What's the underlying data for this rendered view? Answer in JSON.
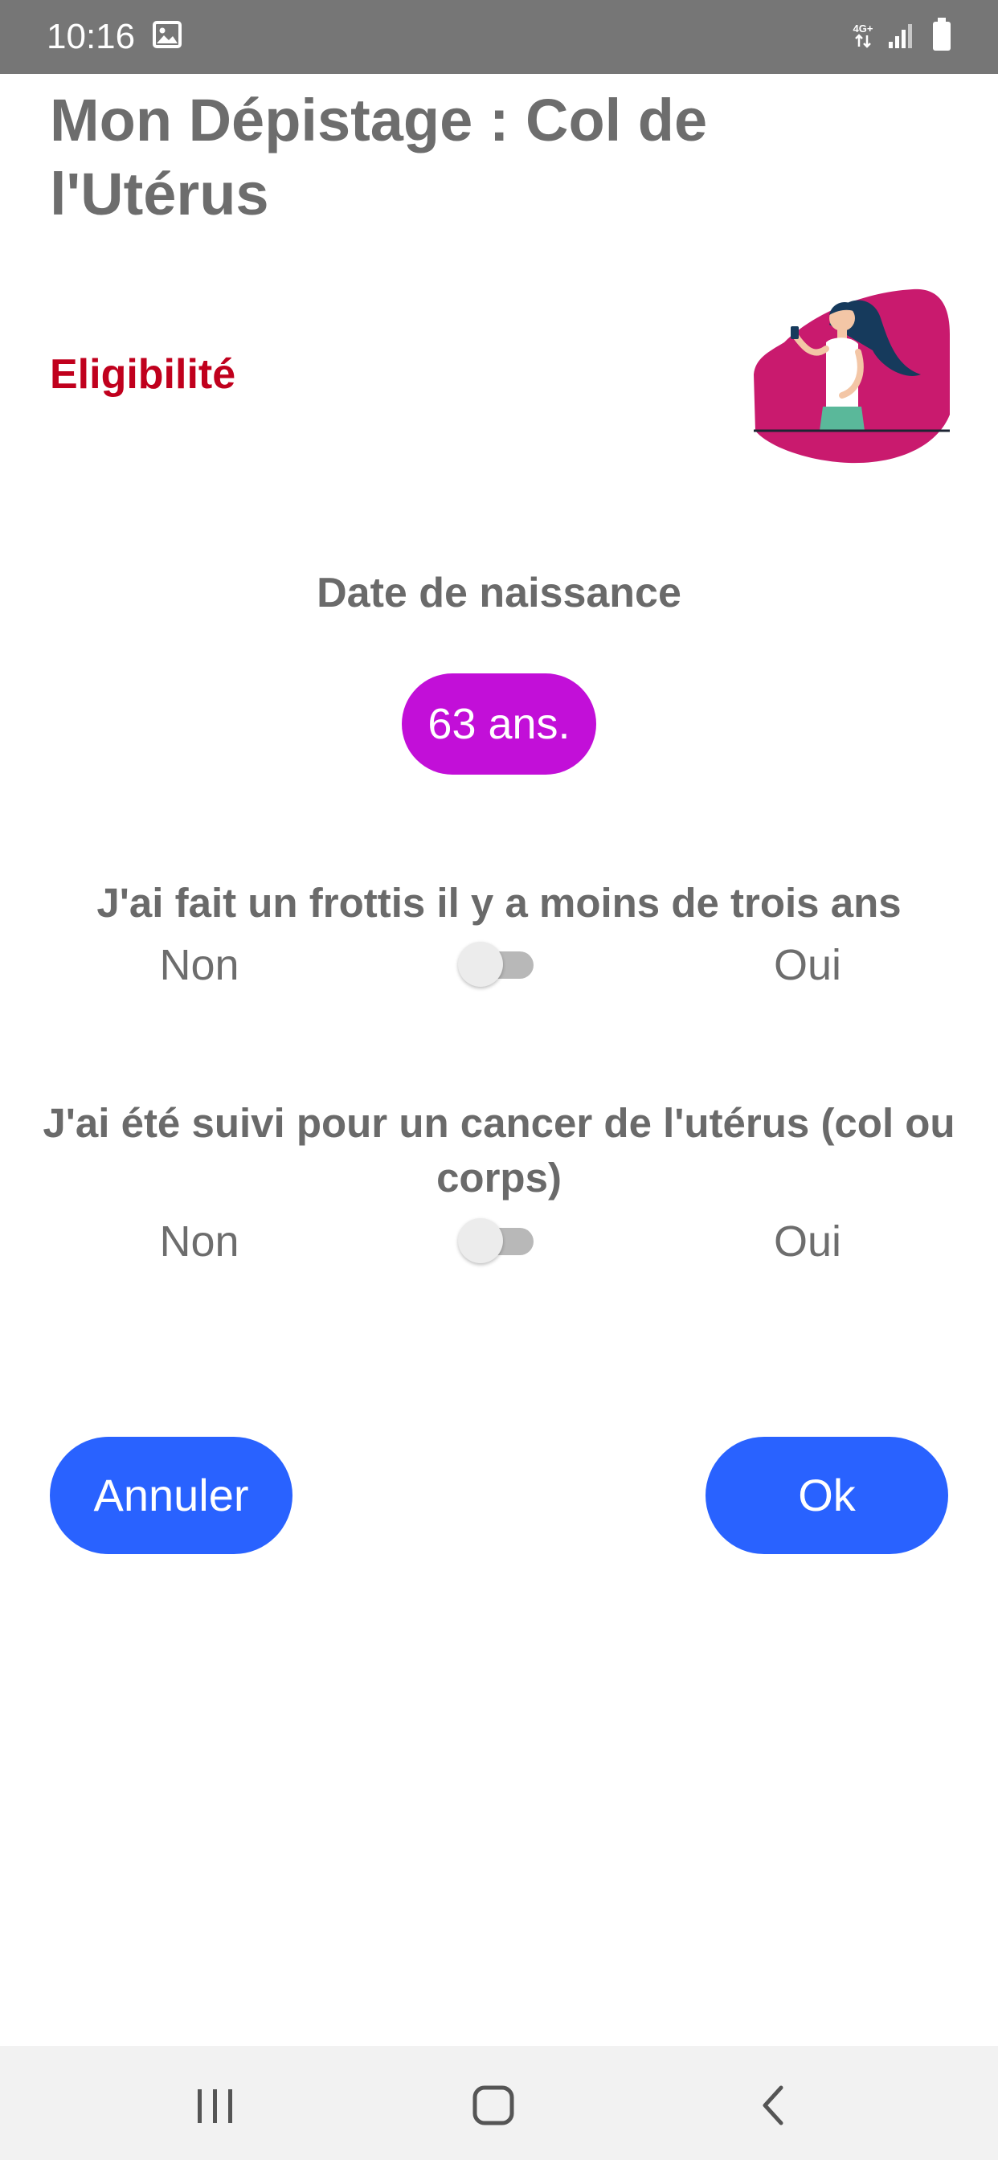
{
  "status_bar": {
    "time": "10:16",
    "network_label": "4G+",
    "icons": [
      "gallery-icon",
      "network-4g-icon",
      "signal-icon",
      "battery-icon"
    ]
  },
  "page": {
    "title": "Mon Dépistage : Col de l'Utérus",
    "section_title": "Eligibilité",
    "illustration": "woman-with-phone-illustration"
  },
  "birth_date": {
    "label": "Date de naissance",
    "value": "63 ans."
  },
  "questions": [
    {
      "label": "J'ai fait un frottis il y a moins de trois ans",
      "no": "Non",
      "yes": "Oui",
      "checked": false
    },
    {
      "label": "J'ai été suivi pour un cancer de l'utérus (col ou corps)",
      "no": "Non",
      "yes": "Oui",
      "checked": false
    }
  ],
  "actions": {
    "cancel": "Annuler",
    "ok": "Ok"
  },
  "colors": {
    "status_bar": "#767676",
    "title": "#6d6d6d",
    "section_title": "#c0001d",
    "age_pill": "#c20fd8",
    "button": "#2962ff",
    "illustration_bg": "#c91a6e"
  },
  "nav_bar": {
    "icons": [
      "recent-apps-icon",
      "home-icon",
      "back-icon"
    ]
  }
}
